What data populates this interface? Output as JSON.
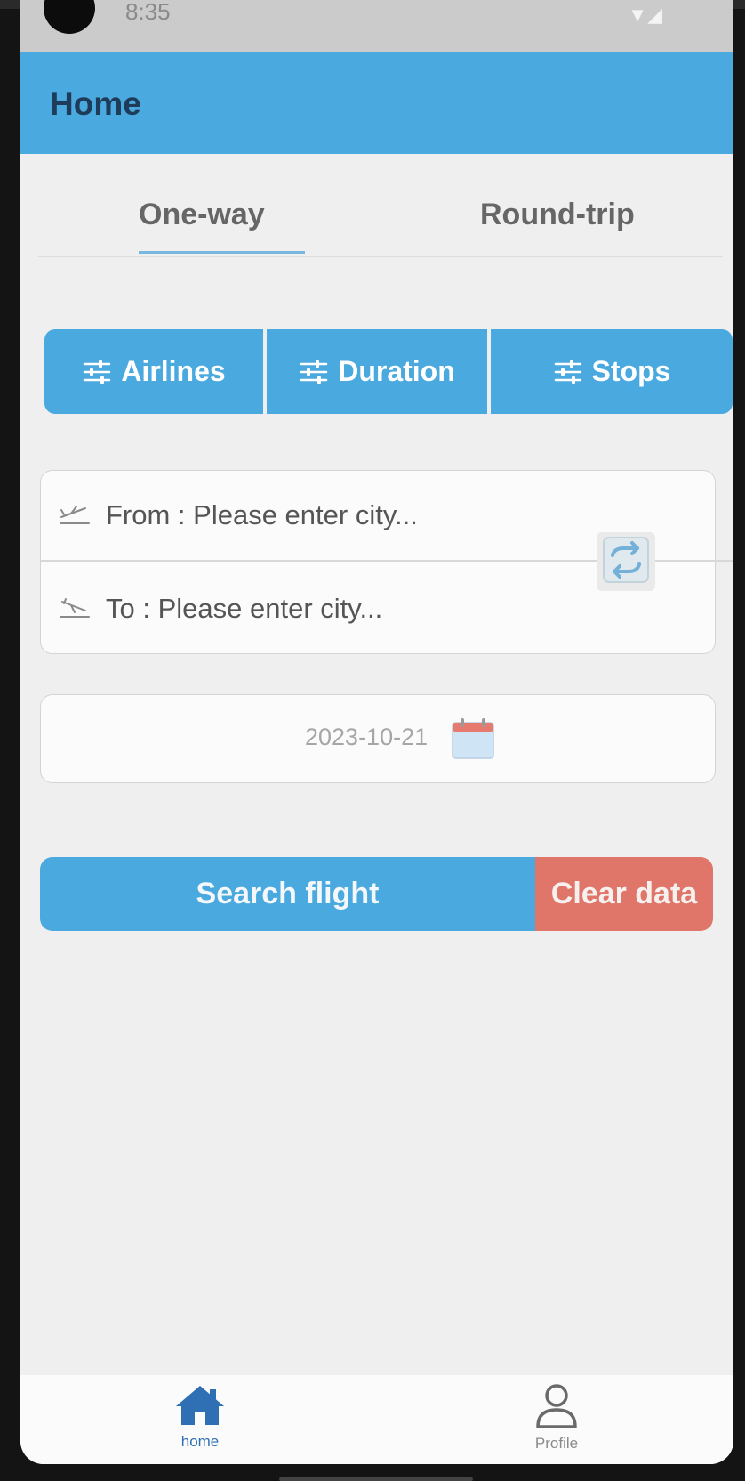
{
  "status_bar": {
    "time": "8:35"
  },
  "appbar": {
    "title": "Home"
  },
  "tabs": [
    {
      "label": "One-way",
      "selected": true
    },
    {
      "label": "Round-trip",
      "selected": false
    }
  ],
  "filters": [
    {
      "label": "Airlines",
      "icon": "sliders-icon"
    },
    {
      "label": "Duration",
      "icon": "sliders-icon"
    },
    {
      "label": "Stops",
      "icon": "sliders-icon"
    }
  ],
  "route": {
    "from_placeholder": "From : Please enter city...",
    "to_placeholder": "To : Please enter city...",
    "from_icon": "plane-takeoff-icon",
    "to_icon": "plane-landing-icon",
    "swap_icon": "swap-icon"
  },
  "date": {
    "value": "2023-10-21",
    "icon": "calendar-icon"
  },
  "actions": {
    "search_label": "Search flight",
    "clear_label": "Clear data"
  },
  "bottom_nav": [
    {
      "label": "home",
      "icon": "home-icon",
      "active": true
    },
    {
      "label": "Profile",
      "icon": "profile-icon",
      "active": false
    }
  ],
  "colors": {
    "primary": "#4aa9de",
    "danger": "#e07669",
    "appbar_title": "#1e3b59",
    "background": "#efefef"
  }
}
